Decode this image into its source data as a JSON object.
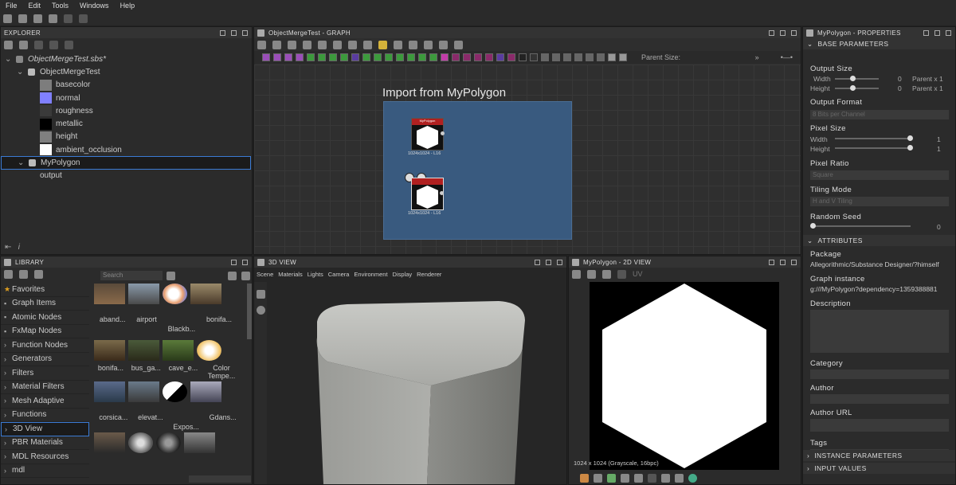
{
  "menu": [
    "File",
    "Edit",
    "Tools",
    "Windows",
    "Help"
  ],
  "explorer": {
    "title": "EXPLORER",
    "package": "ObjectMergeTest.sbs*",
    "graphs": [
      {
        "name": "ObjectMergeTest",
        "outputs": [
          {
            "label": "basecolor",
            "color": "#7d7d7d"
          },
          {
            "label": "normal",
            "color": "#8080ff"
          },
          {
            "label": "roughness",
            "color": "#3a3a3a"
          },
          {
            "label": "metallic",
            "color": "#000000"
          },
          {
            "label": "height",
            "color": "#7f7f7f"
          },
          {
            "label": "ambient_occlusion",
            "color": "#ffffff"
          }
        ]
      },
      {
        "name": "MyPolygon",
        "outputs": [
          {
            "label": "output"
          }
        ]
      }
    ]
  },
  "graph": {
    "title": "ObjectMergeTest - GRAPH",
    "parent_size_label": "Parent Size:",
    "frame_title": "Import from MyPolygon",
    "node1_caption": "1024x1024 - L16",
    "node2_caption": "1024x1024 - L16",
    "node_header": "MyPolygon"
  },
  "library": {
    "title": "LIBRARY",
    "search_placeholder": "Search",
    "categories": [
      {
        "label": "Favorites",
        "icon": "star-icon"
      },
      {
        "label": "Graph Items",
        "icon": "graph-icon"
      },
      {
        "label": "Atomic Nodes",
        "icon": "atomic-icon"
      },
      {
        "label": "FxMap Nodes",
        "icon": "fxmap-icon"
      },
      {
        "label": "Function Nodes",
        "chev": true
      },
      {
        "label": "Generators",
        "chev": true
      },
      {
        "label": "Filters",
        "chev": true
      },
      {
        "label": "Material Filters",
        "chev": true
      },
      {
        "label": "Mesh Adaptive",
        "chev": true
      },
      {
        "label": "Functions",
        "chev": true
      },
      {
        "label": "3D View",
        "chev": true,
        "selected": true
      },
      {
        "label": "PBR Materials",
        "chev": true
      },
      {
        "label": "MDL Resources",
        "chev": true
      },
      {
        "label": "mdl",
        "chev": true
      }
    ],
    "thumbs_row1": [
      "aband...",
      "airport",
      "Blackb...",
      "bonifa..."
    ],
    "thumbs_row2": [
      "bonifa...",
      "bus_ga...",
      "cave_e...",
      "Color Tempe..."
    ],
    "thumbs_row3": [
      "corsica...",
      "elevat...",
      "Expos...",
      "Gdans..."
    ]
  },
  "view3d": {
    "title": "3D VIEW",
    "menu": [
      "Scene",
      "Materials",
      "Lights",
      "Camera",
      "Environment",
      "Display",
      "Renderer"
    ]
  },
  "view2d": {
    "title": "MyPolygon - 2D VIEW",
    "uv_label": "UV",
    "status": "1024 x 1024 (Grayscale, 16bpc)"
  },
  "properties": {
    "title": "MyPolygon - PROPERTIES",
    "base_section": "BASE PARAMETERS",
    "output_size": {
      "label": "Output Size",
      "width_label": "Width",
      "height_label": "Height",
      "width_value": "0",
      "height_value": "0",
      "width_mode": "Parent x 1",
      "height_mode": "Parent x 1"
    },
    "output_format": {
      "label": "Output Format",
      "value": "8 Bits per Channel"
    },
    "pixel_size": {
      "label": "Pixel Size",
      "width_label": "Width",
      "height_label": "Height",
      "width_value": "1",
      "height_value": "1"
    },
    "pixel_ratio": {
      "label": "Pixel Ratio",
      "value": "Square"
    },
    "tiling_mode": {
      "label": "Tiling Mode",
      "value": "H and V Tiling"
    },
    "random_seed": {
      "label": "Random Seed",
      "value": "0"
    },
    "attributes_section": "ATTRIBUTES",
    "package_label": "Package",
    "package_value": "Allegorithmic/Substance Designer/?himself",
    "graph_instance_label": "Graph instance",
    "graph_instance_value": "g:///MyPolygon?dependency=1359388881",
    "description_label": "Description",
    "category_label": "Category",
    "author_label": "Author",
    "author_url_label": "Author URL",
    "tags_label": "Tags",
    "instance_section": "INSTANCE PARAMETERS",
    "input_section": "INPUT VALUES"
  }
}
